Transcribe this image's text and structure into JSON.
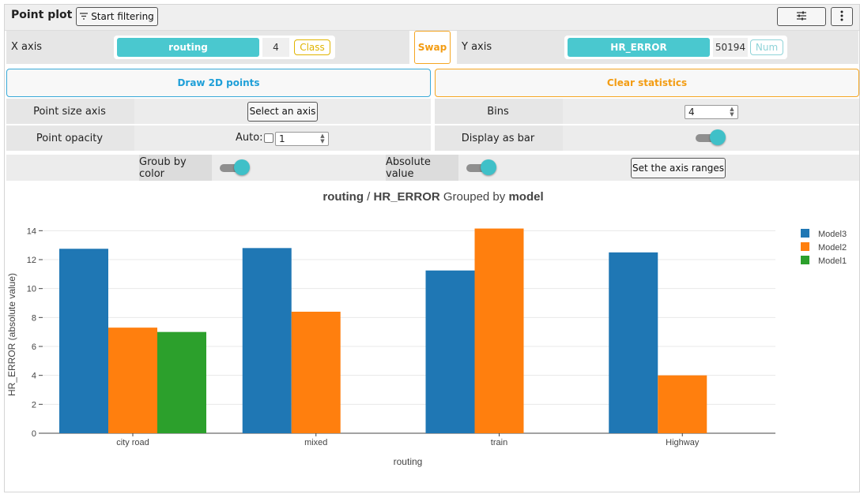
{
  "header": {
    "title": "Point plot",
    "filter_label": "Start filtering"
  },
  "axes": {
    "x_label": "X axis",
    "x_name": "routing",
    "x_count": "4",
    "x_type": "Class",
    "swap_label": "Swap",
    "y_label": "Y axis",
    "y_name": "HR_ERROR",
    "y_count": "50194",
    "y_type": "Num"
  },
  "actions": {
    "draw_label": "Draw 2D points",
    "clear_label": "Clear statistics"
  },
  "options": {
    "point_size_label": "Point size axis",
    "select_axis_label": "Select an axis",
    "point_opacity_label": "Point opacity",
    "auto_label": "Auto:",
    "opacity_value": "1",
    "bins_label": "Bins",
    "bins_value": "4",
    "display_bar_label": "Display as bar",
    "group_color_label": "Groub by color",
    "absolute_label": "Absolute value",
    "set_ranges_label": "Set the axis ranges"
  },
  "chart_data": {
    "type": "bar",
    "title_parts": {
      "x": "routing",
      "sep": " / ",
      "y": "HR_ERROR",
      "mid": " Grouped by ",
      "group": "model"
    },
    "categories": [
      "city road",
      "mixed",
      "train",
      "Highway"
    ],
    "series": [
      {
        "name": "Model3",
        "color": "#1f77b4",
        "values": [
          12.75,
          12.8,
          11.25,
          12.5
        ]
      },
      {
        "name": "Model2",
        "color": "#ff7f0e",
        "values": [
          7.3,
          8.4,
          14.15,
          4.0
        ]
      },
      {
        "name": "Model1",
        "color": "#2ca02c",
        "values": [
          7.0,
          null,
          null,
          null
        ]
      }
    ],
    "xlabel": "routing",
    "ylabel": "HR_ERROR (absolute value)",
    "ylim": [
      0,
      15
    ],
    "yticks": [
      0,
      2,
      4,
      6,
      8,
      10,
      12,
      14
    ],
    "grid": true,
    "legend": "top-right"
  }
}
